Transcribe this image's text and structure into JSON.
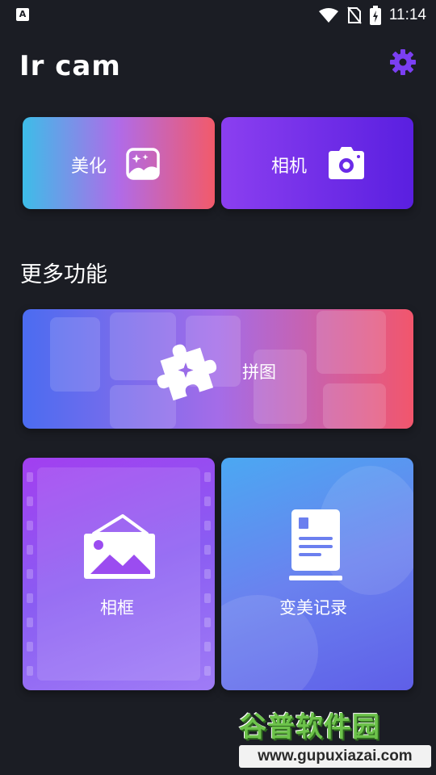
{
  "status_bar": {
    "left_badge": "A",
    "time": "11:14"
  },
  "header": {
    "app_title": "Ir cam",
    "settings_icon": "gear-icon",
    "accent_color": "#7b3ff2"
  },
  "top_cards": {
    "beautify": {
      "label": "美化",
      "icon": "image-sparkle-icon"
    },
    "camera": {
      "label": "相机",
      "icon": "camera-icon"
    }
  },
  "section": {
    "title": "更多功能"
  },
  "features": {
    "puzzle": {
      "label": "拼图",
      "icon": "puzzle-icon"
    },
    "frame": {
      "label": "相框",
      "icon": "photo-frame-icon"
    },
    "record": {
      "label": "变美记录",
      "icon": "document-icon"
    }
  },
  "watermark": {
    "logo_text": "谷普软件园",
    "url": "www.gupuxiazai.com"
  }
}
